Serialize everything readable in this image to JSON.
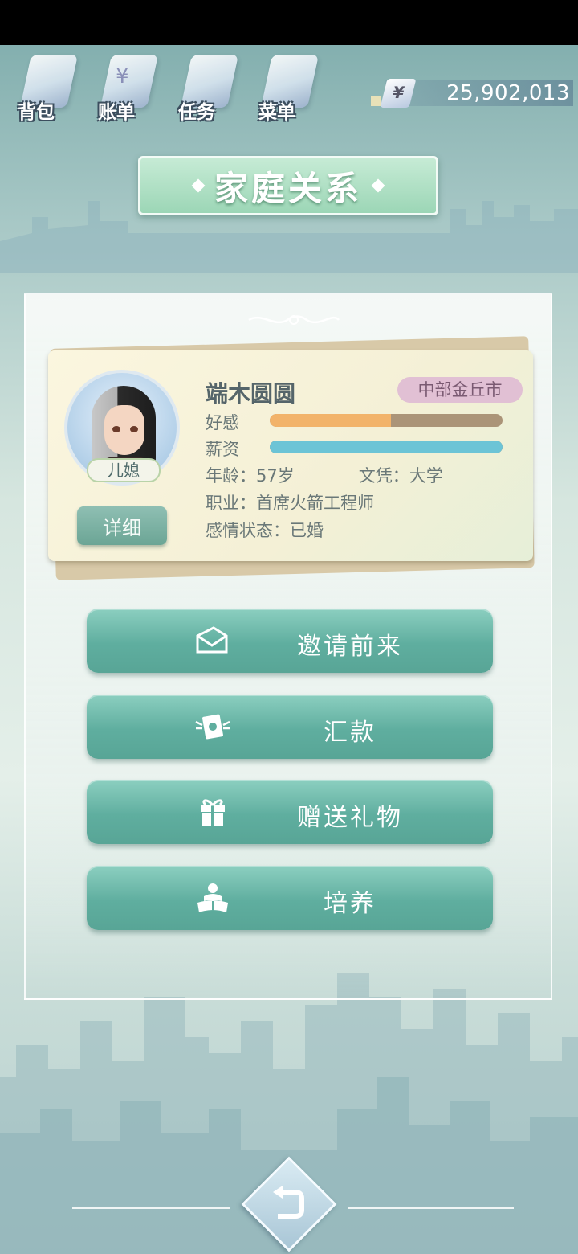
{
  "top_menu": {
    "items": [
      {
        "label": "背包",
        "icon": "backpack-icon"
      },
      {
        "label": "账单",
        "icon": "bill-icon",
        "glyph": "¥"
      },
      {
        "label": "任务",
        "icon": "task-icon"
      },
      {
        "label": "菜单",
        "icon": "menu-icon"
      }
    ]
  },
  "currency": {
    "symbol": "¥",
    "amount": "25,902,013"
  },
  "title": "家庭关系",
  "profile": {
    "relation": "儿媳",
    "detail_label": "详细",
    "name": "端木圆圆",
    "location": "中部金丘市",
    "favor_label": "好感",
    "favor_level": 0.52,
    "salary_label": "薪资",
    "salary_level": 1.0,
    "age_text": "年龄：57岁",
    "education_text": "文凭：大学",
    "job_text": "职业：首席火箭工程师",
    "relationship_text": "感情状态：已婚"
  },
  "actions": [
    {
      "label": "邀请前来",
      "icon": "invite-letter-icon"
    },
    {
      "label": "汇款",
      "icon": "money-transfer-icon"
    },
    {
      "label": "赠送礼物",
      "icon": "gift-icon"
    },
    {
      "label": "培养",
      "icon": "nurture-reading-icon"
    }
  ],
  "colors": {
    "favor_fill": "#f2b36a",
    "favor_track": "#ab9478",
    "salary_fill": "#6cc4d6",
    "button_teal": "#5fae9f",
    "location_badge": "#e1c0d4"
  }
}
